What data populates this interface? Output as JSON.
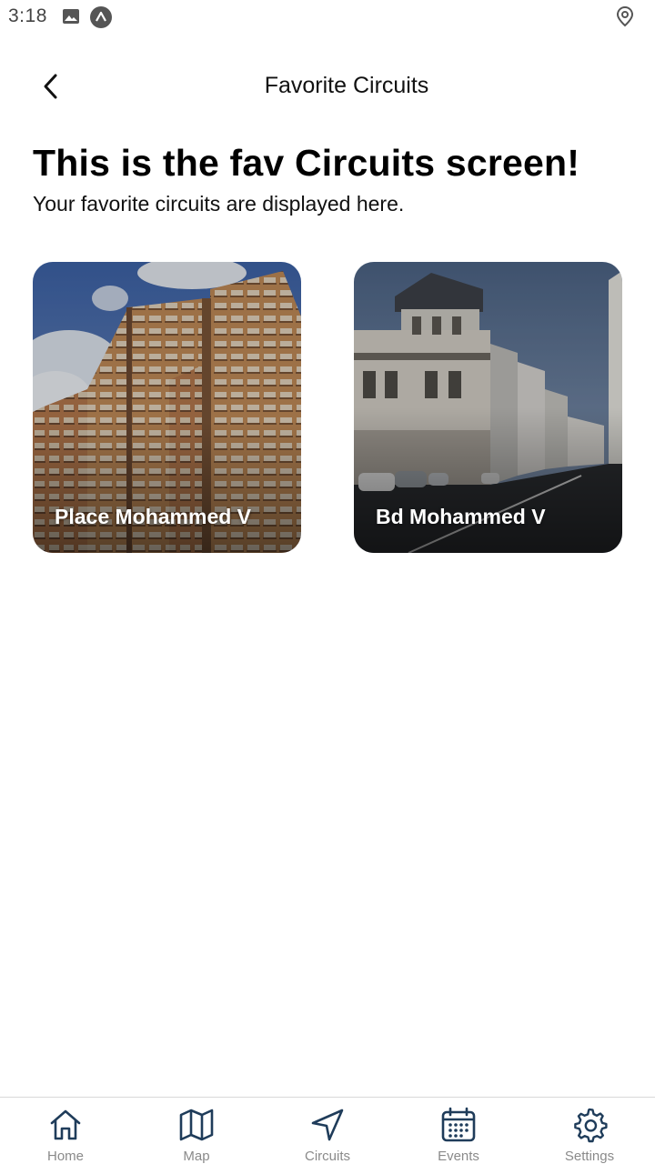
{
  "status_bar": {
    "time": "3:18",
    "icons": [
      "image-icon",
      "expo-icon",
      "location-icon"
    ]
  },
  "header": {
    "title": "Favorite Circuits",
    "back_icon": "chevron-left-icon"
  },
  "main": {
    "headline": "This is the fav Circuits screen!",
    "subtitle": "Your favorite circuits are displayed here.",
    "cards": [
      {
        "label": "Place Mohammed V"
      },
      {
        "label": "Bd Mohammed V"
      }
    ]
  },
  "bottom_nav": {
    "items": [
      {
        "label": "Home",
        "icon": "home-icon"
      },
      {
        "label": "Map",
        "icon": "map-icon"
      },
      {
        "label": "Circuits",
        "icon": "navigation-icon"
      },
      {
        "label": "Events",
        "icon": "calendar-icon"
      },
      {
        "label": "Settings",
        "icon": "gear-icon"
      }
    ],
    "icon_color": "#1f3c5a"
  }
}
